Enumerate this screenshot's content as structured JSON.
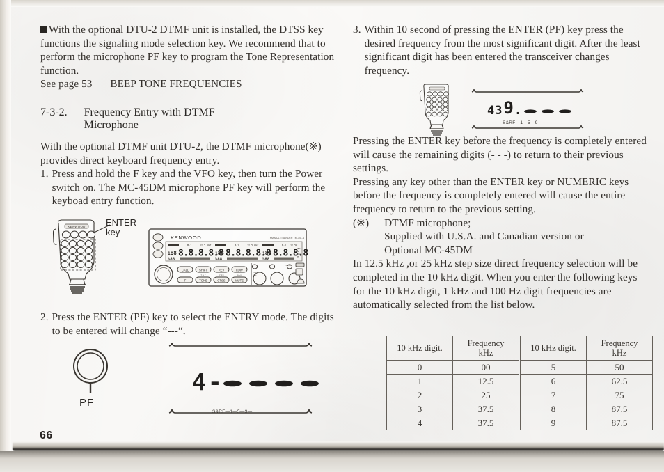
{
  "document": {
    "page_number": "66"
  },
  "left_column": {
    "note_paragraph": "With the optional DTU-2 DTMF unit is installed, the DTSS key functions the signaling mode selection key. We recommend that to perform the microphone PF key to program the Tone Representation function.",
    "see_page_line": "See page 53",
    "see_page_ref": "BEEP TONE FREQUENCIES",
    "section_number": "7-3-2.",
    "section_title_line1": "Frequency Entry with DTMF",
    "section_title_line2": "Microphone",
    "intro_paragraph": "With the optional DTMF unit DTU-2, the DTMF microphone(※) provides direct keyboard frequency entry.",
    "steps": [
      {
        "number": "1.",
        "text": "Press and hold the F key and the VFO key, then turn the Power switch on. The MC-45DM microphone PF key will perform the keyboad entry function."
      },
      {
        "number": "2.",
        "text": "Press the ENTER (PF) key to select the ENTRY mode. The digits to be entered will change “---“."
      }
    ],
    "figure_mic": {
      "brand": "KENWOOD",
      "callout_line1": "ENTER",
      "callout_line2": "key"
    },
    "figure_radio": {
      "brand": "KENWOOD",
      "model_text": "FM MULTI BANDER  TM-741 A",
      "buttons_row1": [
        "CALL",
        "SHIFT",
        "REV",
        "LOW"
      ],
      "buttons_row2": [
        "F",
        "TONE",
        "CTSS",
        "MUTE"
      ],
      "power_label": "POWER",
      "lcd_digits": "8.8.8.8.8"
    },
    "figure_pf": {
      "knob_label": "PF",
      "lcd_value": "4-",
      "lcd_dashes": "- - - -",
      "meter_scale": "S&RF—1—5—9—"
    }
  },
  "right_column": {
    "steps": [
      {
        "number": "3.",
        "text": "Within 10 second of pressing the ENTER (PF) key press the desired frequency from the most significant digit. After the least significant digit has been entered the transceiver changes frequency."
      }
    ],
    "figure_entry": {
      "lcd_prefix": "43",
      "lcd_active_digit": "9",
      "lcd_dashes": "- - -",
      "meter_scale": "S&RF—1—5—9—"
    },
    "paragraph_1": "Pressing the ENTER key before the frequency is completely entered will cause the remaining digits (- - -) to return to their previous settings.",
    "paragraph_2": "Pressing any key other than the ENTER key or NUMERIC keys before the frequency is completely entered will cause the entire frequency to return to the previous setting.",
    "footnote": {
      "marker": "(※)",
      "line1": "DTMF microphone;",
      "line2": "Supplied with U.S.A. and Canadian version or",
      "line3": "Optional MC-45DM"
    },
    "paragraph_3": "In 12.5 kHz ,or 25 kHz step size direct frequency selection will be completed in the 10 kHz digit. When you enter the following keys for the 10 kHz digit, 1 kHz and 100 Hz digit  frequencies are automatically selected from the list below.",
    "table": {
      "headers": [
        "10 kHz digit.",
        "Frequency\nkHz",
        "10 kHz digit.",
        "Frequency\nkHz"
      ],
      "header_left_digit": "10 kHz digit.",
      "header_left_freq_l1": "Frequency",
      "header_left_freq_l2": "kHz",
      "header_right_digit": "10 kHz digit.",
      "header_right_freq_l1": "Frequency",
      "header_right_freq_l2": "kHz",
      "rows": [
        [
          "0",
          "00",
          "5",
          "50"
        ],
        [
          "1",
          "12.5",
          "6",
          "62.5"
        ],
        [
          "2",
          "25",
          "7",
          "75"
        ],
        [
          "3",
          "37.5",
          "8",
          "87.5"
        ],
        [
          "4",
          "37.5",
          "9",
          "87.5"
        ]
      ]
    }
  }
}
